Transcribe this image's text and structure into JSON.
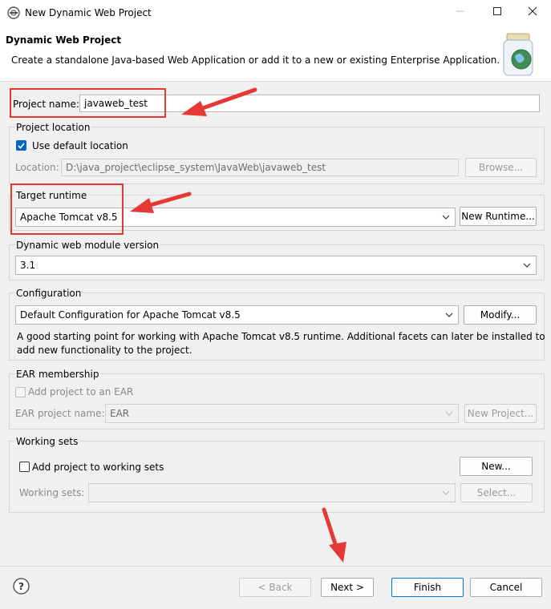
{
  "window": {
    "title": "New Dynamic Web Project"
  },
  "header": {
    "title": "Dynamic Web Project",
    "description": "Create a standalone Java-based Web Application or add it to a new or existing Enterprise Application."
  },
  "project_name": {
    "label": "Project name:",
    "value": "javaweb_test"
  },
  "project_location": {
    "group_label": "Project location",
    "use_default_label": "Use default location",
    "use_default_checked": true,
    "location_label": "Location:",
    "location_value": "D:\\java_project\\eclipse_system\\JavaWeb\\javaweb_test",
    "browse_label": "Browse..."
  },
  "target_runtime": {
    "group_label": "Target runtime",
    "value": "Apache Tomcat v8.5",
    "new_runtime_label": "New Runtime..."
  },
  "module_version": {
    "group_label": "Dynamic web module version",
    "value": "3.1"
  },
  "configuration": {
    "group_label": "Configuration",
    "value": "Default Configuration for Apache Tomcat v8.5",
    "modify_label": "Modify...",
    "description_line1": "A good starting point for working with Apache Tomcat v8.5 runtime. Additional facets can later be installed to",
    "description_line2": "add new functionality to the project."
  },
  "ear": {
    "group_label": "EAR membership",
    "add_label": "Add project to an EAR",
    "project_label": "EAR project name:",
    "project_value": "EAR",
    "new_project_label": "New Project..."
  },
  "working_sets": {
    "group_label": "Working sets",
    "add_label": "Add project to working sets",
    "new_label": "New...",
    "sets_label": "Working sets:",
    "select_label": "Select..."
  },
  "footer": {
    "back": "< Back",
    "next": "Next >",
    "finish": "Finish",
    "cancel": "Cancel"
  },
  "colors": {
    "annotation": "#e53935",
    "accent": "#0078d7",
    "checkbox": "#0067c0"
  }
}
